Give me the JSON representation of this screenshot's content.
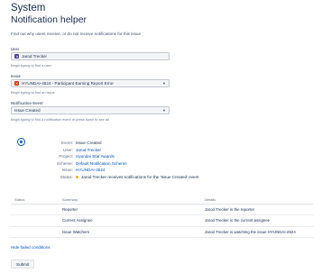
{
  "header": {
    "system_title": "System",
    "page_title": "Notification helper",
    "description": "Find out why users receive, or do not receive notifications for this issue"
  },
  "form": {
    "user": {
      "label": "User",
      "value": "Jarod Trecker",
      "hint": "Begin typing to find a user"
    },
    "issue": {
      "label": "Issue",
      "value": "HYUNDAI-4524 - Participant Earning Report Error",
      "hint": "Begin typing to find an issue"
    },
    "event": {
      "label": "Notification Event",
      "value": "Issue Created",
      "hint": "Begin typing to find a notification event or press down to see all"
    }
  },
  "result": {
    "rows": [
      {
        "key": "Event:",
        "value": "Issue Created"
      },
      {
        "key": "User:",
        "value": "Jarod Trecker"
      },
      {
        "key": "Project:",
        "value": "Hyundai Star Awards"
      },
      {
        "key": "Scheme:",
        "value": "Default Notification Scheme"
      },
      {
        "key": "Issue:",
        "value": "HYUNDAI-4524"
      },
      {
        "key": "Status:",
        "value": "Jarod Trecker receives notifications for the 'Issue Created' event"
      }
    ]
  },
  "table": {
    "headers": {
      "status": "Status",
      "summary": "Summary",
      "details": "Details"
    },
    "rows": [
      {
        "summary": "Reporter",
        "details": "Jarod Trecker is the reporter"
      },
      {
        "summary": "Current Assignee",
        "details": "Jarod Trecker is the current assignee"
      },
      {
        "summary": "Issue Watchers",
        "details": "Jarod Trecker is watching the issue HYUNDAI-4524"
      }
    ]
  },
  "footer": {
    "hide_link": "Hide failed conditions",
    "submit_label": "Submit"
  },
  "colors": {
    "link": "#0052cc",
    "text": "#172b4d",
    "status_dot": "#ffab00",
    "issue_icon": "#de350b",
    "avatar": "#5243aa"
  },
  "icons": {
    "user_avatar": "avatar-icon",
    "issue_type": "bug-icon",
    "dropdown": "chevron-down-icon",
    "result": "target-icon",
    "status": "status-dot-icon"
  }
}
